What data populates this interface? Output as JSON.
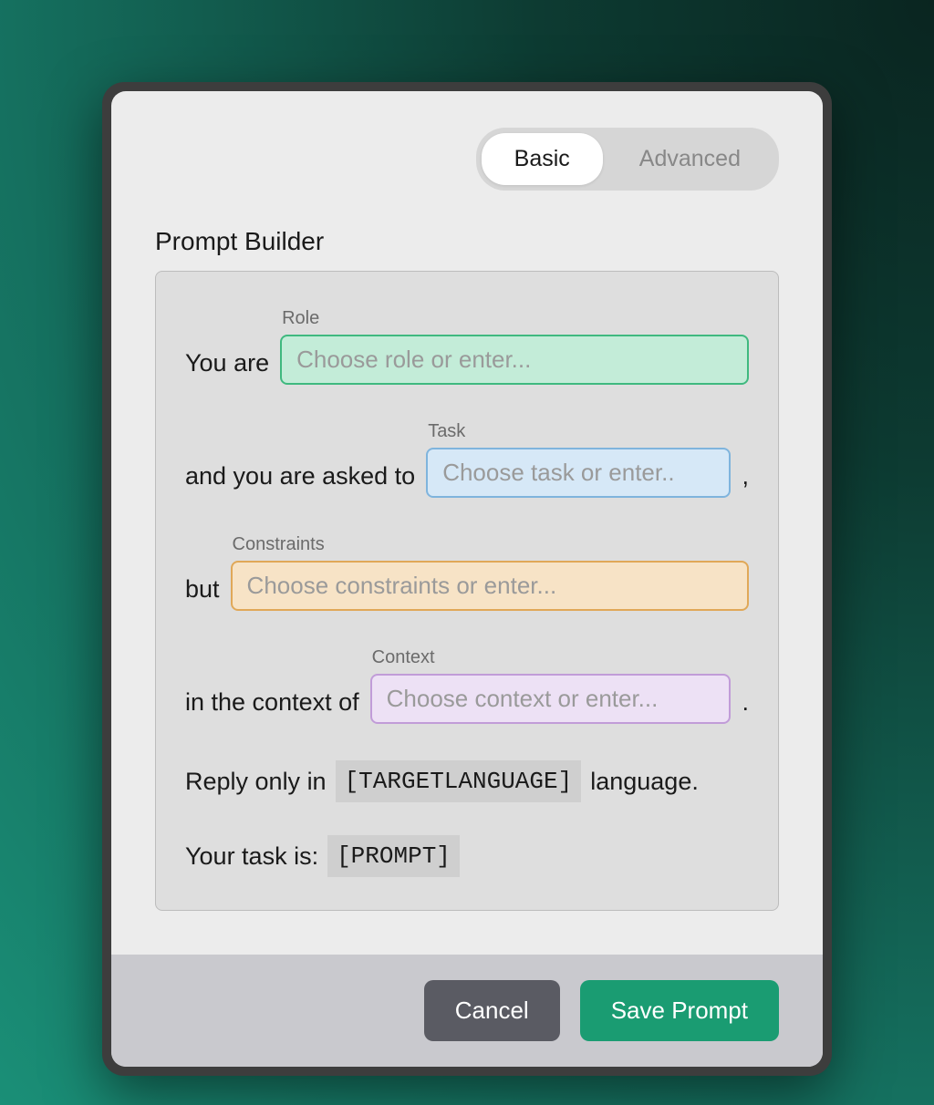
{
  "tabs": {
    "basic": "Basic",
    "advanced": "Advanced"
  },
  "title": "Prompt Builder",
  "builder": {
    "role": {
      "prefix": "You are",
      "label": "Role",
      "placeholder": "Choose role or enter..."
    },
    "task": {
      "prefix": "and you are asked to",
      "label": "Task",
      "placeholder": "Choose task or enter..",
      "suffix": ","
    },
    "constraints": {
      "prefix": "but",
      "label": "Constraints",
      "placeholder": "Choose constraints or enter..."
    },
    "context": {
      "prefix": "in the context of",
      "label": "Context",
      "placeholder": "Choose context or enter...",
      "suffix": "."
    },
    "language_line": {
      "pre": "Reply only in",
      "chip": "[TARGETLANGUAGE]",
      "post": "language."
    },
    "taskline": {
      "pre": "Your task is:",
      "chip": "[PROMPT]"
    }
  },
  "footer": {
    "cancel": "Cancel",
    "save": "Save Prompt"
  }
}
